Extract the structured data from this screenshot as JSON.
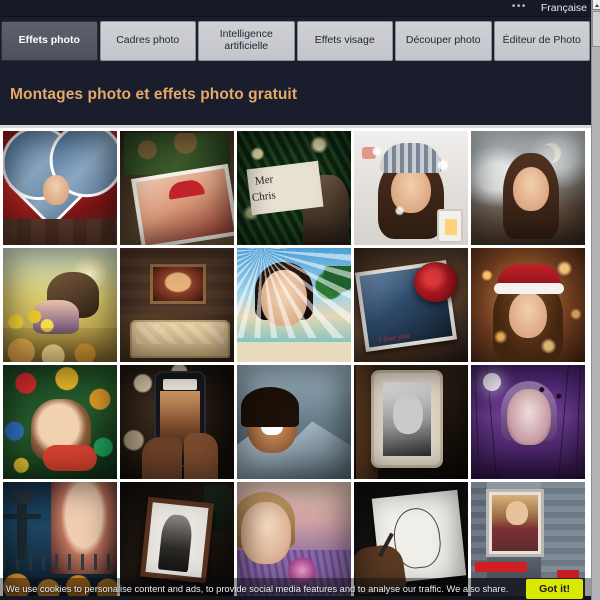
{
  "topbar": {
    "dots_menu": "•••",
    "language": "Française",
    "language_icon": "chevron-down-icon"
  },
  "nav": {
    "tabs": [
      {
        "label": "Effets photo",
        "active": true
      },
      {
        "label": "Cadres photo",
        "active": false
      },
      {
        "label": "Intelligence\nartificielle",
        "line1": "Intelligence",
        "line2": "artificielle",
        "active": false
      },
      {
        "label": "Effets visage",
        "active": false
      },
      {
        "label": "Découper photo",
        "active": false
      },
      {
        "label": "Éditeur de Photo",
        "active": false
      }
    ]
  },
  "header": {
    "page_title": "Montages photo et effets photo gratuit",
    "title_color": "#e3a86a",
    "background_color": "#1a1e2c"
  },
  "grid": {
    "columns": 5,
    "rows": 4,
    "items": [
      {
        "name": "heart-frame-red-bow",
        "alt": "Cadre coeur sur noeud rouge"
      },
      {
        "name": "christmas-pinecone-frame",
        "alt": "Cadre photo pommes de pin"
      },
      {
        "name": "merry-christmas-sign",
        "alt": "Panneau Merry Christmas"
      },
      {
        "name": "winter-beanie-portrait",
        "alt": "Portrait bonnet d'hiver neige"
      },
      {
        "name": "moon-smoke-portrait",
        "alt": "Portrait lune et brume"
      },
      {
        "name": "autumn-couple-field",
        "alt": "Couple champ d'automne"
      },
      {
        "name": "interior-wall-portrait",
        "alt": "Portrait encadré mur intérieur"
      },
      {
        "name": "beach-sun-rays",
        "alt": "Plage tropicale rayons de soleil"
      },
      {
        "name": "red-rose-photo-card",
        "alt": "Rose rouge sur photo"
      },
      {
        "name": "santa-hat-sparkle",
        "alt": "Bonnet de Noël étincelles"
      },
      {
        "name": "christmas-baubles-portrait",
        "alt": "Boules de Noël portrait"
      },
      {
        "name": "phone-in-hands",
        "alt": "Téléphone tenu dans les mains"
      },
      {
        "name": "snow-mountain-man",
        "alt": "Homme montagnes enneigées"
      },
      {
        "name": "ornate-frame-bw",
        "alt": "Cadre baroque noir et blanc"
      },
      {
        "name": "purple-halloween-forest",
        "alt": "Forêt violette halloween"
      },
      {
        "name": "halloween-scarecrow",
        "alt": "Épouvantail et citrouilles"
      },
      {
        "name": "vintage-bw-frame",
        "alt": "Cadre vintage noir et blanc"
      },
      {
        "name": "lavender-field-woman",
        "alt": "Femme champ de lavande"
      },
      {
        "name": "pencil-sketch-hand",
        "alt": "Croquis au crayon à la main"
      },
      {
        "name": "city-billboard",
        "alt": "Panneau publicitaire en ville"
      }
    ]
  },
  "cookie_banner": {
    "text": "We use cookies to personalise content and ads, to provide social media features and to analyse our traffic. We also share.",
    "button_label": "Got it!",
    "button_color": "#dbe802"
  },
  "scrollbar": {
    "up_arrow_icon": "scroll-up-arrow-icon",
    "thumb": "scrollbar-thumb"
  }
}
